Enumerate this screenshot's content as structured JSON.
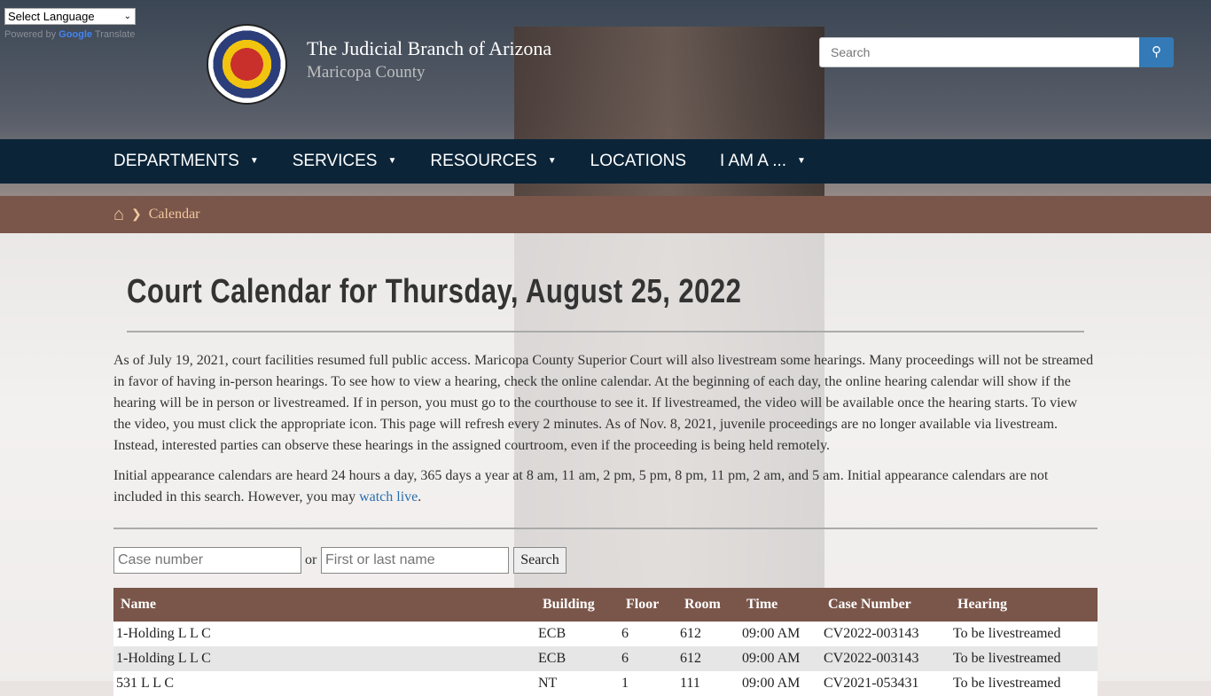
{
  "translate": {
    "select_label": "Select Language",
    "powered_by": "Powered by",
    "google": "Google",
    "translate": "Translate"
  },
  "header": {
    "title": "The Judicial Branch of Arizona",
    "subtitle": "Maricopa County",
    "search_placeholder": "Search"
  },
  "nav": [
    {
      "label": "DEPARTMENTS",
      "dropdown": true
    },
    {
      "label": "SERVICES",
      "dropdown": true
    },
    {
      "label": "RESOURCES",
      "dropdown": true
    },
    {
      "label": "LOCATIONS",
      "dropdown": false
    },
    {
      "label": "I AM A ...",
      "dropdown": true
    }
  ],
  "breadcrumb": {
    "current": "Calendar"
  },
  "page": {
    "heading": "Court Calendar for Thursday, August 25, 2022",
    "para1": "As of July 19, 2021, court facilities resumed full public access. Maricopa County Superior Court will also livestream some hearings. Many proceedings will not be streamed in favor of having in-person hearings. To see how to view a hearing, check the online calendar. At the beginning of each day, the online hearing calendar will show if the hearing will be in person or livestreamed. If in person, you must go to the courthouse to see it. If livestreamed, the video will be available once the hearing starts. To view the video, you must click the appropriate icon. This page will refresh every 2 minutes. As of Nov. 8, 2021, juvenile proceedings are no longer available via livestream. Instead, interested parties can observe these hearings in the assigned courtroom, even if the proceeding is being held remotely.",
    "para2": "Initial appearance calendars are heard 24 hours a day, 365 days a year at 8 am, 11 am, 2 pm, 5 pm, 8 pm, 11 pm, 2 am, and 5 am. Initial appearance calendars are not included in this search. However, you may ",
    "watch_link": "watch live",
    "para2_end": "."
  },
  "filter": {
    "case_placeholder": "Case number",
    "or": "or",
    "name_placeholder": "First or last name",
    "search_button": "Search"
  },
  "table": {
    "headers": [
      "Name",
      "Building",
      "Floor",
      "Room",
      "Time",
      "Case Number",
      "Hearing"
    ],
    "rows": [
      [
        "1-Holding L L C",
        "ECB",
        "6",
        "612",
        "09:00 AM",
        "CV2022-003143",
        "To be livestreamed"
      ],
      [
        "1-Holding L L C",
        "ECB",
        "6",
        "612",
        "09:00 AM",
        "CV2022-003143",
        "To be livestreamed"
      ],
      [
        "531 L L C",
        "NT",
        "1",
        "111",
        "09:00 AM",
        "CV2021-053431",
        "To be livestreamed"
      ]
    ]
  }
}
